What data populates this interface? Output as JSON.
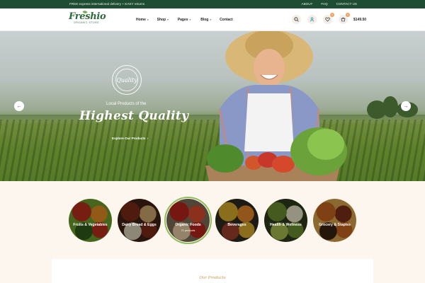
{
  "topbar": {
    "promo": "FREE express international delivery + EASY returns",
    "links": [
      "ABOUT",
      "FAQ",
      "CONTACT US"
    ]
  },
  "header": {
    "logo_word": "Freshio",
    "logo_sub": "ORGANIC STORE",
    "nav": [
      {
        "label": "Home",
        "caret": "▾"
      },
      {
        "label": "Shop",
        "caret": "▾"
      },
      {
        "label": "Pages",
        "caret": "▾"
      },
      {
        "label": "Blog",
        "caret": "▾"
      },
      {
        "label": "Contact",
        "caret": ""
      }
    ],
    "icons": [
      "search-icon",
      "user-icon",
      "heart-icon",
      "cart-icon"
    ],
    "wishlist_count": "0",
    "cart_count": "0",
    "cart_total": "$149.50"
  },
  "hero": {
    "seal_text": "Quality",
    "pretitle": "Local Products of the",
    "title": "Highest Quality",
    "cta": "Explore Our Products",
    "cta_arrow": "›",
    "prev_arrow": "←",
    "next_arrow": "→"
  },
  "categories": [
    {
      "label": "Fruits & Vegetables",
      "count": "",
      "colors": [
        "#b72f1c",
        "#e18a24",
        "#6a9d2c",
        "#2f5a1b"
      ]
    },
    {
      "label": "Dairy Bread & Eggs",
      "count": "",
      "colors": [
        "#7c2a18",
        "#c9a56b",
        "#3e2115",
        "#d9d0b8"
      ]
    },
    {
      "label": "Organic Foods",
      "count": "71 products",
      "colors": [
        "#b5251b",
        "#d84b2f",
        "#7c6c55",
        "#e4c9a0"
      ]
    },
    {
      "label": "Beverages",
      "count": "",
      "colors": [
        "#d4a92a",
        "#e0842a",
        "#2e2a21",
        "#9b3e2c"
      ]
    },
    {
      "label": "Health & Wellness",
      "count": "",
      "colors": [
        "#6a8b2e",
        "#e6e0c8",
        "#2f3a1b",
        "#a4b94c"
      ]
    },
    {
      "label": "Grocery & Staples",
      "count": "",
      "colors": [
        "#c4631f",
        "#7a2f18",
        "#d6a24a",
        "#3a2210"
      ]
    }
  ],
  "section": {
    "script_heading": "Our Products"
  },
  "colors": {
    "brand_green": "#1f4d34",
    "accent_green": "#8dbd5c",
    "accent_orange": "#f0a060"
  }
}
